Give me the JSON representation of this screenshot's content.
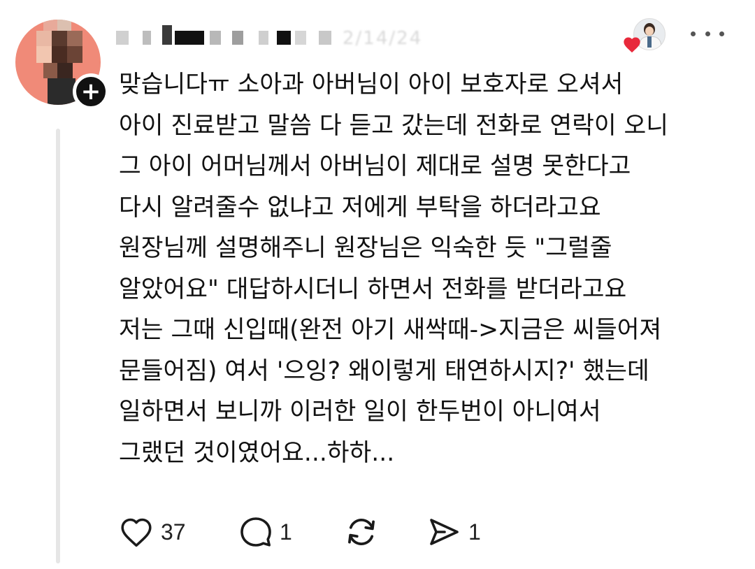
{
  "post": {
    "author": {
      "username_text": "2/14/24",
      "follow_label": "+"
    },
    "body_lines": [
      "맞습니다ㅠ 소아과 아버님이 아이 보호자로 오셔서",
      "아이 진료받고 말씀 다 듣고 갔는데 전화로 연락이 오니",
      "그 아이 어머님께서 아버님이 제대로 설명 못한다고",
      "다시 알려줄수 없냐고 저에게 부탁을 하더라고요",
      "원장님께 설명해주니 원장님은 익숙한 듯 \"그럴줄",
      "알았어요\" 대답하시더니 하면서 전화를 받더라고요",
      "저는 그때 신입때(완전 아기 새싹때->지금은 씨들어져",
      "문들어짐) 여서 '으잉? 왜이렇게 태연하시지?' 했는데",
      "일하면서 보니까 이러한 일이 한두번이 아니여서",
      "그랬던 것이였어요...하하..."
    ],
    "actions": {
      "like": {
        "icon": "heart-outline-icon",
        "count": "37"
      },
      "reply": {
        "icon": "comment-bubble-icon",
        "count": "1"
      },
      "repost": {
        "icon": "repost-arrows-icon"
      },
      "share": {
        "icon": "send-arrow-icon",
        "count": "1"
      }
    }
  },
  "colors": {
    "avatar_bg": "#f08a78",
    "heart_badge": "#e8293b",
    "thread_line": "#e6e6e6",
    "text": "#111111"
  }
}
